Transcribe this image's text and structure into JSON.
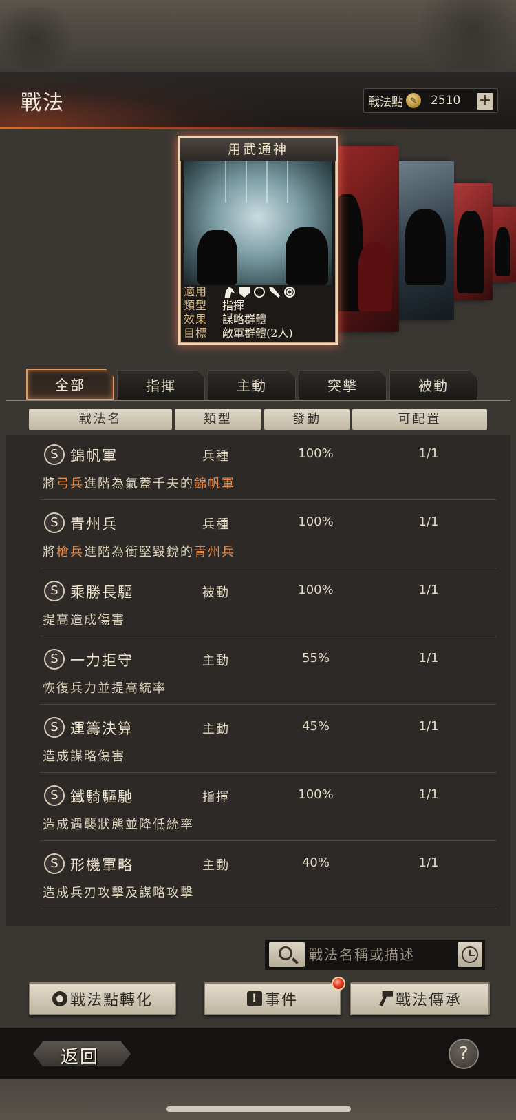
{
  "header": {
    "title": "戰法",
    "points_label": "戰法點",
    "points_value": "2510",
    "plus_label": "+"
  },
  "featured_card": {
    "name": "用武通神",
    "info": [
      {
        "key": "適用",
        "value": ""
      },
      {
        "key": "類型",
        "value": "指揮"
      },
      {
        "key": "效果",
        "value": "謀略群體"
      },
      {
        "key": "目標",
        "value": "敵軍群體(2人)"
      }
    ],
    "applicable_icons": [
      "horse-icon",
      "shield-icon",
      "bow-icon",
      "spear-icon",
      "wheel-icon"
    ]
  },
  "tabs": [
    "全部",
    "指揮",
    "主動",
    "突擊",
    "被動"
  ],
  "active_tab": 0,
  "columns": [
    "戰法名",
    "類型",
    "發動",
    "可配置"
  ],
  "rows": [
    {
      "badge": "S",
      "name": "錦帆軍",
      "type": "兵種",
      "rate": "100%",
      "slots": "1/1",
      "desc": [
        {
          "t": "將",
          "h": false
        },
        {
          "t": "弓兵",
          "h": true
        },
        {
          "t": "進階為氣蓋千夫的",
          "h": false
        },
        {
          "t": "錦帆軍",
          "h": true
        }
      ]
    },
    {
      "badge": "S",
      "name": "青州兵",
      "type": "兵種",
      "rate": "100%",
      "slots": "1/1",
      "desc": [
        {
          "t": "將",
          "h": false
        },
        {
          "t": "槍兵",
          "h": true
        },
        {
          "t": "進階為衝堅毀銳的",
          "h": false
        },
        {
          "t": "青州兵",
          "h": true
        }
      ]
    },
    {
      "badge": "S",
      "name": "乘勝長驅",
      "type": "被動",
      "rate": "100%",
      "slots": "1/1",
      "desc": [
        {
          "t": "提高造成傷害",
          "h": false
        }
      ]
    },
    {
      "badge": "S",
      "name": "一力拒守",
      "type": "主動",
      "rate": "55%",
      "slots": "1/1",
      "desc": [
        {
          "t": "恢復兵力並提高統率",
          "h": false
        }
      ]
    },
    {
      "badge": "S",
      "name": "運籌決算",
      "type": "主動",
      "rate": "45%",
      "slots": "1/1",
      "desc": [
        {
          "t": "造成謀略傷害",
          "h": false
        }
      ]
    },
    {
      "badge": "S",
      "name": "鐵騎驅馳",
      "type": "指揮",
      "rate": "100%",
      "slots": "1/1",
      "desc": [
        {
          "t": "造成遇襲狀態並降低統率",
          "h": false
        }
      ]
    },
    {
      "badge": "S",
      "name": "形機軍略",
      "type": "主動",
      "rate": "40%",
      "slots": "1/1",
      "desc": [
        {
          "t": "造成兵刃攻擊及謀略攻擊",
          "h": false
        }
      ]
    }
  ],
  "search": {
    "placeholder": "戰法名稱或描述"
  },
  "actions": {
    "convert_label": "戰法點轉化",
    "event_label": "事件",
    "inherit_label": "戰法傳承"
  },
  "footer": {
    "back_label": "返回",
    "help_label": "?"
  },
  "colors": {
    "accent": "#e58a4a",
    "active_tab_border": "#e59a5d"
  }
}
